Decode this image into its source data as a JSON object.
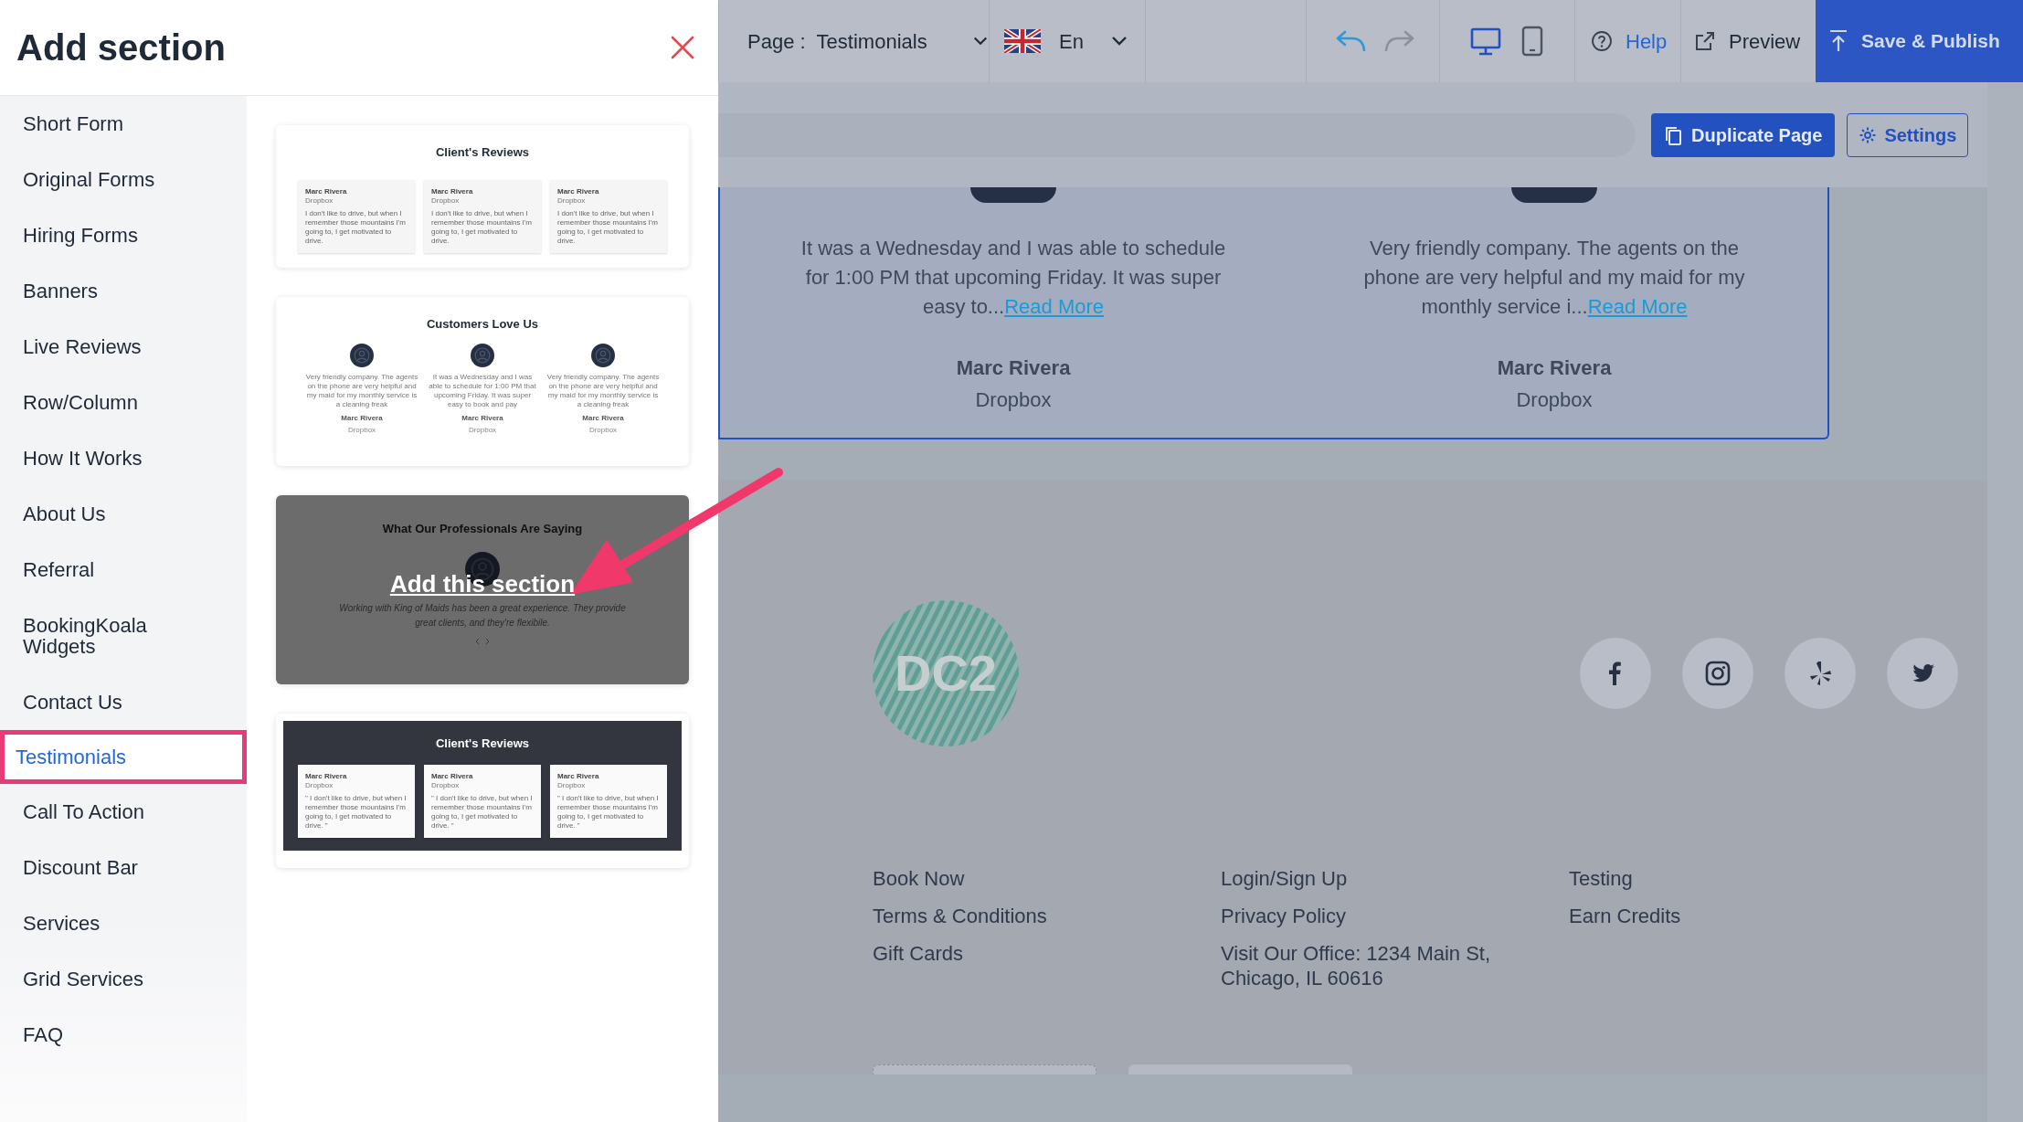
{
  "panel": {
    "title": "Add section"
  },
  "categories": [
    {
      "label": "Short Form",
      "selected": false
    },
    {
      "label": "Original Forms",
      "selected": false
    },
    {
      "label": "Hiring Forms",
      "selected": false
    },
    {
      "label": "Banners",
      "selected": false
    },
    {
      "label": "Live Reviews",
      "selected": false
    },
    {
      "label": "Row/Column",
      "selected": false
    },
    {
      "label": "How It Works",
      "selected": false
    },
    {
      "label": "About Us",
      "selected": false
    },
    {
      "label": "Referral",
      "selected": false
    },
    {
      "label": "BookingKoala Widgets",
      "selected": false
    },
    {
      "label": "Contact Us",
      "selected": false
    },
    {
      "label": "Testimonials",
      "selected": true
    },
    {
      "label": "Call To Action",
      "selected": false
    },
    {
      "label": "Discount Bar",
      "selected": false
    },
    {
      "label": "Services",
      "selected": false
    },
    {
      "label": "Grid Services",
      "selected": false
    },
    {
      "label": "FAQ",
      "selected": false
    }
  ],
  "templates": [
    {
      "kind": "card_grid",
      "hovered": false,
      "title": "Client's Reviews",
      "cards": [
        {
          "name": "Marc Rivera",
          "company": "Dropbox",
          "text": "I don't like to drive, but when I remember those mountains I'm going to, I get motivated to drive."
        },
        {
          "name": "Marc Rivera",
          "company": "Dropbox",
          "text": "I don't like to drive, but when I remember those mountains I'm going to, I get motivated to drive."
        },
        {
          "name": "Marc Rivera",
          "company": "Dropbox",
          "text": "I don't like to drive, but when I remember those mountains I'm going to, I get motivated to drive."
        }
      ]
    },
    {
      "kind": "avatar_columns",
      "hovered": false,
      "title": "Customers Love Us",
      "cards": [
        {
          "name": "Marc Rivera",
          "company": "Dropbox",
          "text": "Very friendly company. The agents on the phone are very helpful and my maid for my monthly service is a cleaning freak"
        },
        {
          "name": "Marc Rivera",
          "company": "Dropbox",
          "text": "It was a Wednesday and I was able to schedule for 1:00 PM that upcoming Friday. It was super easy to book and pay"
        },
        {
          "name": "Marc Rivera",
          "company": "Dropbox",
          "text": "Very friendly company. The agents on the phone are very helpful and my maid for my monthly service is a cleaning freak"
        }
      ]
    },
    {
      "kind": "carousel",
      "hovered": true,
      "title": "What Our Professionals Are Saying",
      "quote": "Working with King of Maids has been a great experience. They provide great clients, and they're flexibile.",
      "action": "Add this section"
    },
    {
      "kind": "dark_card_grid",
      "hovered": false,
      "title": "Client's Reviews",
      "cards": [
        {
          "name": "Marc Rivera",
          "company": "Dropbox",
          "text": "\" I don't like to drive, but when I remember those mountains I'm going to, I get motivated to drive. \""
        },
        {
          "name": "Marc Rivera",
          "company": "Dropbox",
          "text": "\" I don't like to drive, but when I remember those mountains I'm going to, I get motivated to drive. \""
        },
        {
          "name": "Marc Rivera",
          "company": "Dropbox",
          "text": "\" I don't like to drive, but when I remember those mountains I'm going to, I get motivated to drive. \""
        }
      ]
    }
  ],
  "toolbar": {
    "page_label": "Page :",
    "page": "Testimonials",
    "language": "En",
    "help": "Help",
    "preview": "Preview",
    "publish": "Save & Publish"
  },
  "page_actions": {
    "duplicate": "Duplicate Page",
    "settings": "Settings"
  },
  "testimonials": [
    {
      "text": "It was a Wednesday and I was able to schedule for 1:00 PM that upcoming Friday. It was super easy to...",
      "link": "Read More",
      "name": "Marc Rivera",
      "company": "Dropbox"
    },
    {
      "text": "Very friendly company. The agents on the phone are very helpful and my maid for my monthly service i...",
      "link": "Read More",
      "name": "Marc Rivera",
      "company": "Dropbox"
    }
  ],
  "footer": {
    "logo": "DC2",
    "link_columns": [
      [
        "Book Now",
        "Terms & Conditions",
        "Gift Cards"
      ],
      [
        "Login/Sign Up",
        "Privacy Policy",
        "Visit Our Office: 1234 Main St, Chicago, IL 60616"
      ],
      [
        "Testing",
        "Earn Credits"
      ]
    ]
  }
}
